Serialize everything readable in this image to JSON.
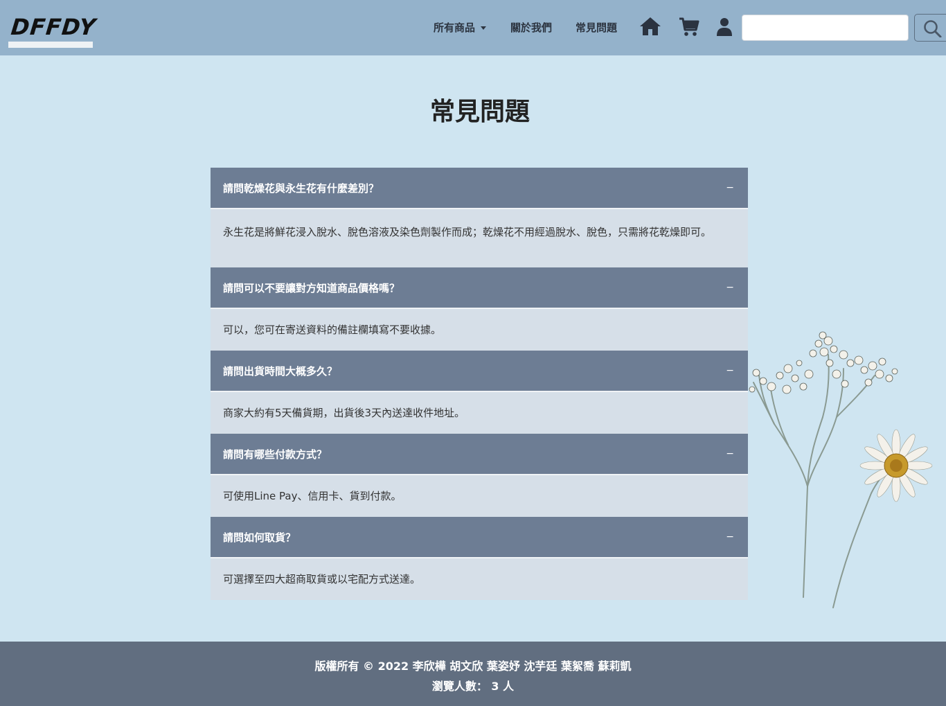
{
  "brand": {
    "logo_text": "DFFDY"
  },
  "nav": {
    "items": [
      {
        "label": "所有商品",
        "has_dropdown": true
      },
      {
        "label": "關於我們",
        "has_dropdown": false
      },
      {
        "label": "常見問題",
        "has_dropdown": false
      }
    ],
    "icons": [
      "home-icon",
      "cart-icon",
      "user-icon",
      "search-icon"
    ],
    "search": {
      "value": "",
      "placeholder": ""
    }
  },
  "page": {
    "title": "常見問題"
  },
  "faq": [
    {
      "question": "請問乾燥花與永生花有什麼差別？",
      "toggle": "−",
      "answer": "永生花是將鮮花浸入脫水、脫色溶液及染色劑製作而成；乾燥花不用經過脫水、脫色，只需將花乾燥即可。"
    },
    {
      "question": "請問可以不要讓對方知道商品價格嗎？",
      "toggle": "−",
      "answer": "可以，您可在寄送資料的備註欄填寫不要收據。"
    },
    {
      "question": "請問出貨時間大概多久？",
      "toggle": "−",
      "answer": "商家大約有5天備貨期，出貨後3天內送達收件地址。"
    },
    {
      "question": "請問有哪些付款方式？",
      "toggle": "−",
      "answer": "可使用Line Pay、信用卡、貨到付款。"
    },
    {
      "question": "請問如何取貨？",
      "toggle": "−",
      "answer": "可選擇至四大超商取貨或以宅配方式送達。"
    }
  ],
  "footer": {
    "copyright": "版權所有 © 2022 李欣樺 胡文欣 葉姿妤 沈芋廷 葉絮喬 蘇莉凱",
    "visitors": "瀏覽人數： 3 人"
  },
  "colors": {
    "navbar": "#94b2cb",
    "page_bg": "#cfe5f1",
    "question_bg": "#6d7d94",
    "answer_bg": "#d6dfe8",
    "footer_bg": "#616e80"
  }
}
